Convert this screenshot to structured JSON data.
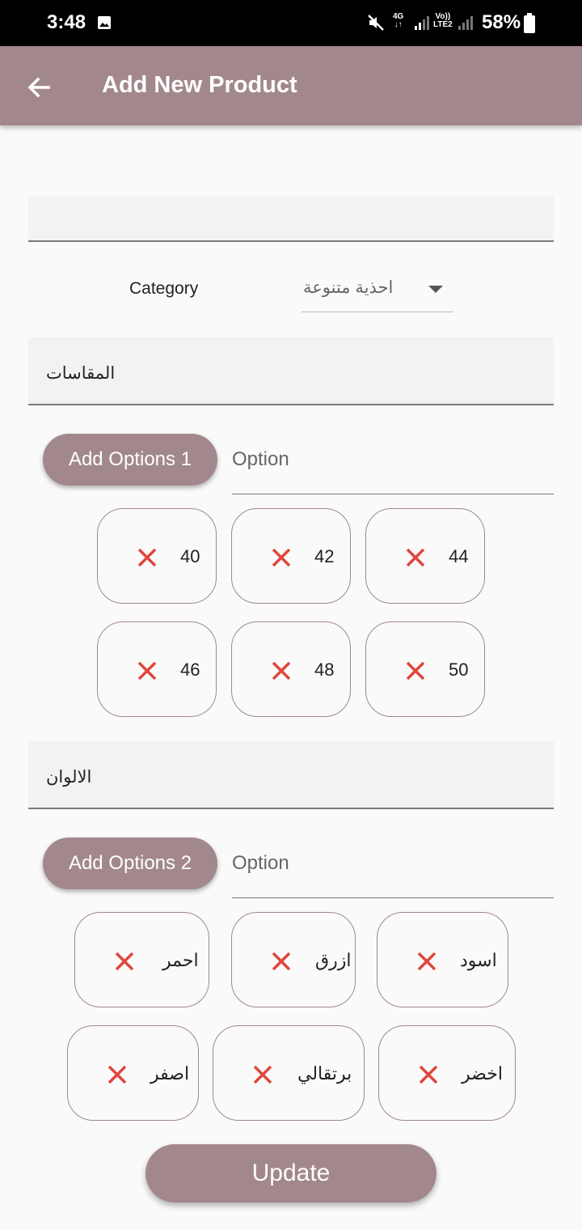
{
  "status_bar": {
    "time": "3:48",
    "network": "4G",
    "volte": "Vo)) LTE2",
    "battery": "58%"
  },
  "app_bar": {
    "title": "Add New Product"
  },
  "form": {
    "name_field_value": "",
    "category_label": "Category",
    "category_value": "احذية متنوعة",
    "option_group_1": {
      "title": "المقاسات",
      "add_button": "Add Options 1",
      "input_placeholder": "Option",
      "options": [
        "40",
        "42",
        "44",
        "46",
        "48",
        "50"
      ]
    },
    "option_group_2": {
      "title": "الالوان",
      "add_button": "Add Options 2",
      "input_placeholder": "Option",
      "options": [
        "احمر",
        "ازرق",
        "اسود",
        "اصفر",
        "برتقالي",
        "اخضر"
      ]
    },
    "update_button": "Update"
  },
  "colors": {
    "primary": "#a2888c",
    "remove_icon": "#e0463c",
    "background": "#fafafa"
  }
}
